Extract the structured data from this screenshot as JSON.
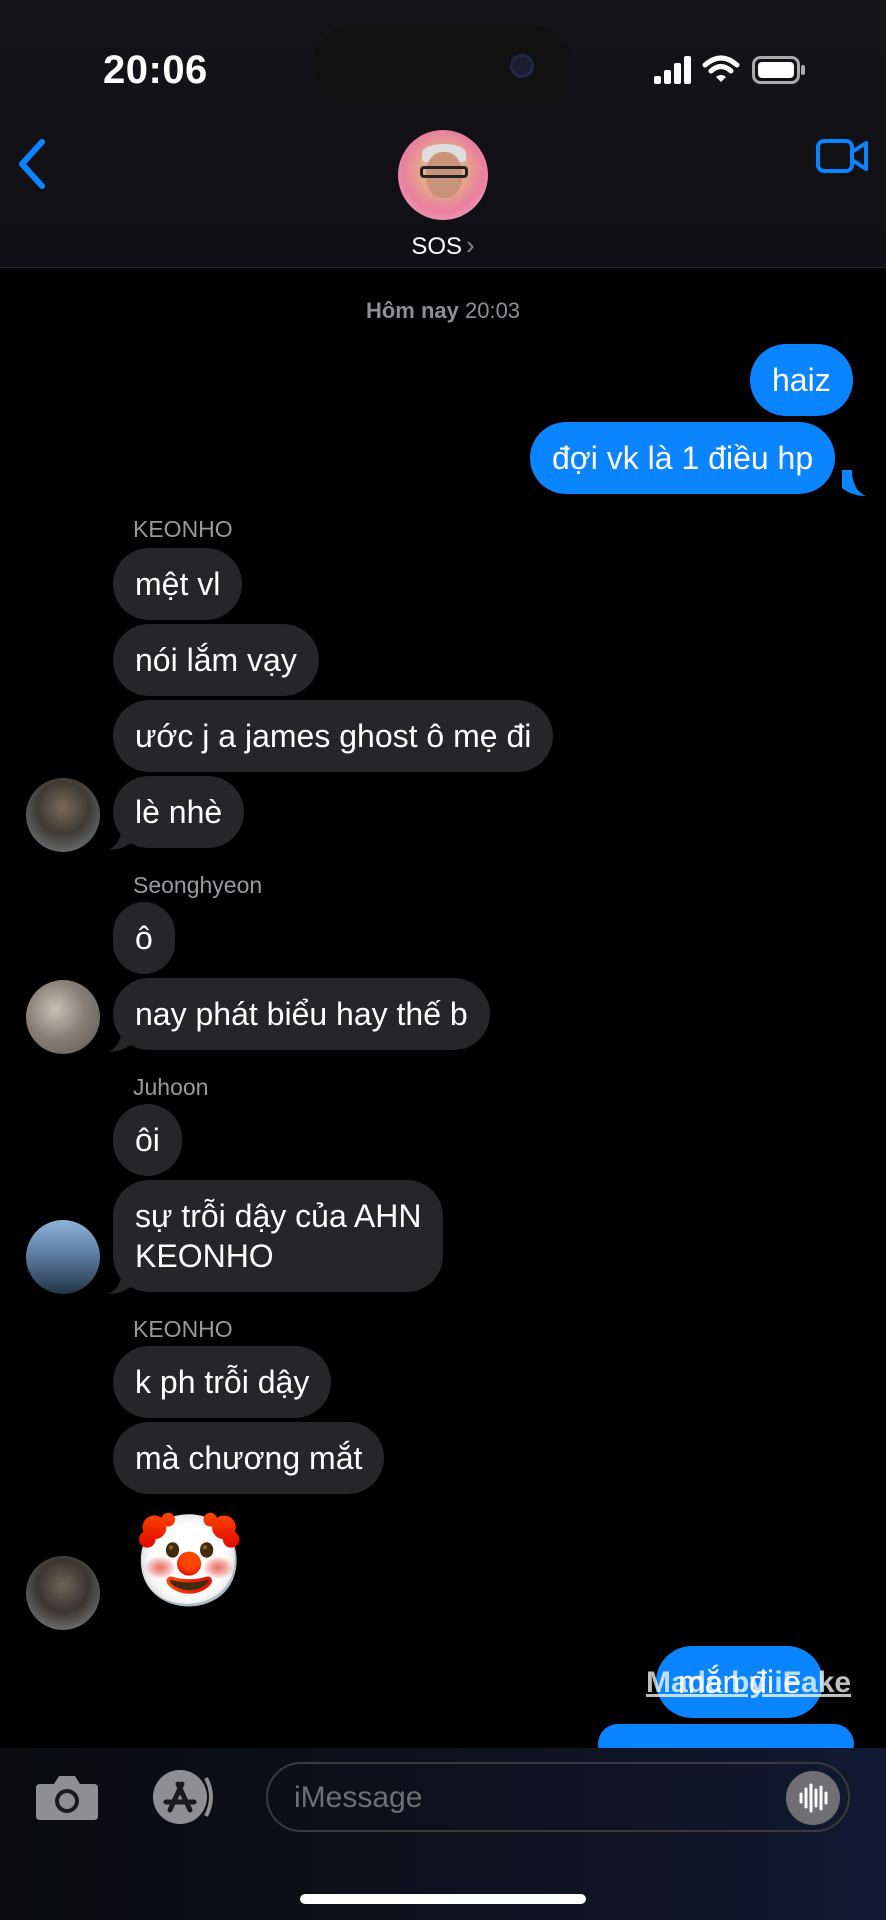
{
  "status": {
    "time": "20:06"
  },
  "header": {
    "group_name": "SOS",
    "chevron": "›"
  },
  "timestamp": {
    "day": "Hôm nay",
    "time": "20:03"
  },
  "messages": {
    "out": [
      "haiz",
      "đợi vk là 1 điều hp",
      "mắn đi e"
    ],
    "keonho_sender": "KEONHO",
    "keonho": [
      "mệt vl",
      "nói lắm vạy",
      "ước j a james ghost ô mẹ đi",
      "lè nhè"
    ],
    "seonghyeon_sender": "Seonghyeon",
    "seonghyeon": [
      "ô",
      "nay phát biểu hay thế b"
    ],
    "juhoon_sender": "Juhoon",
    "juhoon": [
      "ôi",
      "sự trỗi dậy của AHN",
      "KEONHO"
    ],
    "keonho2_sender": "KEONHO",
    "keonho2": [
      "k ph trỗi dậy",
      "mà chương mắt"
    ],
    "emoji": "🤡"
  },
  "watermark": "Made by iFake",
  "composer": {
    "placeholder": "iMessage"
  },
  "colors": {
    "outgoing": "#0a84ff",
    "incoming": "#262628",
    "accent": "#0a84ff"
  },
  "icons": [
    "back-chevron-icon",
    "video-camera-icon",
    "camera-icon",
    "app-store-icon",
    "voice-waveform-icon",
    "cellular-signal-icon",
    "wifi-icon",
    "battery-icon"
  ]
}
